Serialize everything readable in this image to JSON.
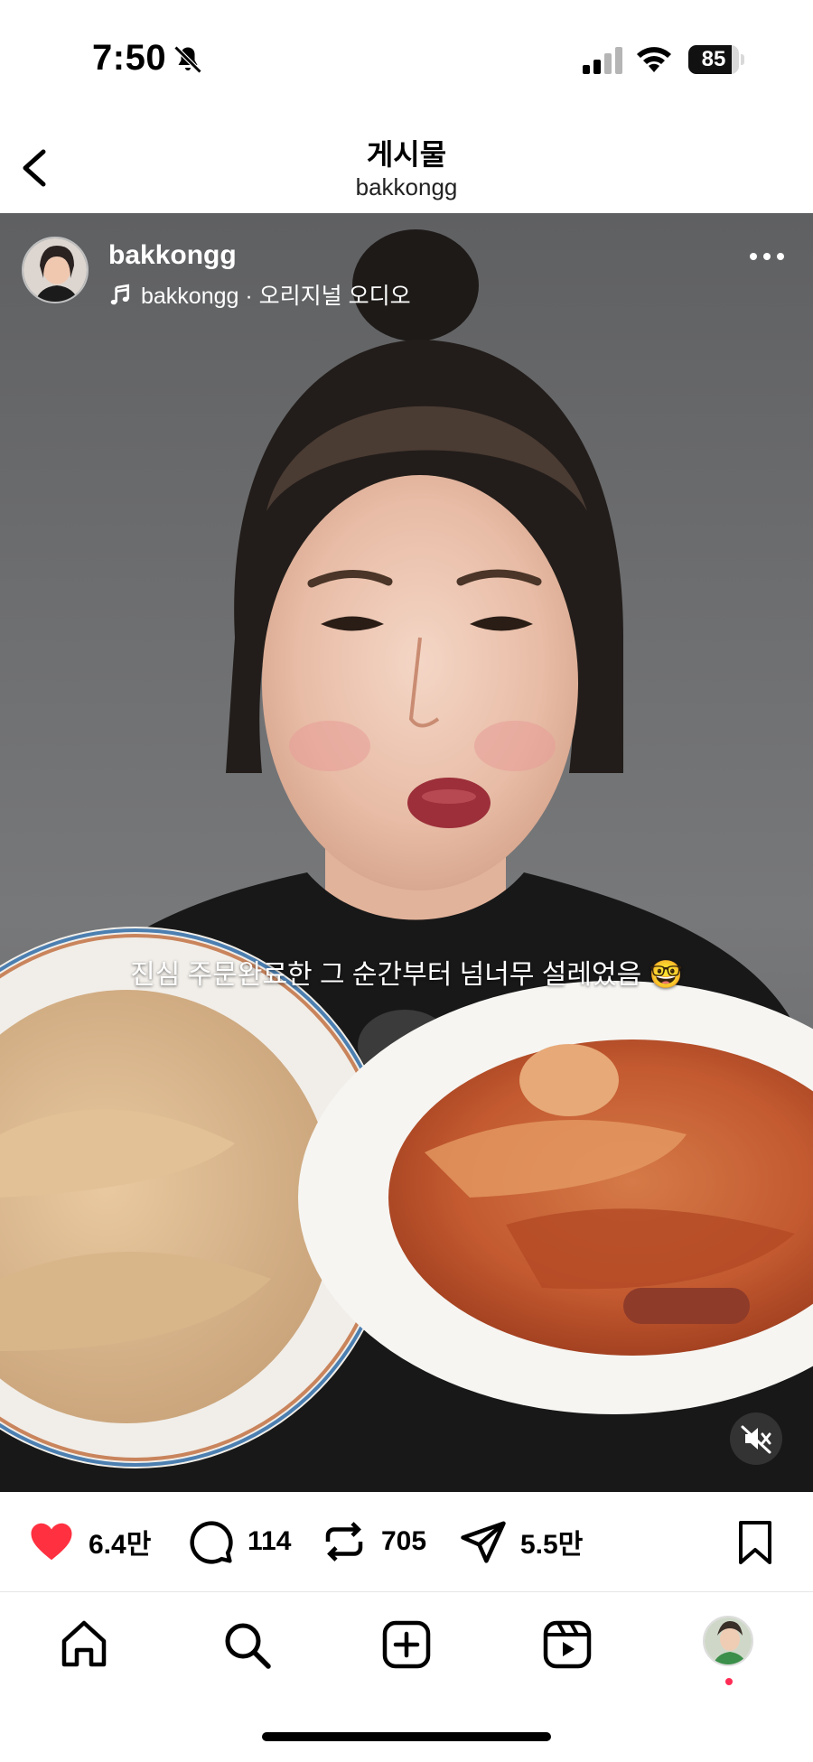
{
  "status_bar": {
    "time": "7:50",
    "battery_level": 85,
    "battery_label": "85"
  },
  "header": {
    "title": "게시물",
    "subtitle": "bakkongg"
  },
  "post": {
    "username": "bakkongg",
    "audio_username": "bakkongg",
    "audio_label": "· 오리지널 오디오",
    "caption": "진심 주문완료한 그 순간부터 넘너무 설레었음 🤓"
  },
  "actions": {
    "likes": "6.4만",
    "comments": "114",
    "reposts": "705",
    "shares": "5.5만"
  },
  "icons": {
    "status": [
      "bell-off-icon",
      "signal-icon",
      "wifi-icon",
      "battery-icon"
    ],
    "actions": [
      "heart-icon",
      "comment-icon",
      "repost-icon",
      "send-icon",
      "bookmark-icon"
    ],
    "nav": [
      "home-icon",
      "search-icon",
      "create-icon",
      "reels-icon",
      "profile-avatar"
    ]
  },
  "colors": {
    "like": "#ff3040",
    "text": "#000000",
    "notification_dot": "#ff2d55"
  }
}
